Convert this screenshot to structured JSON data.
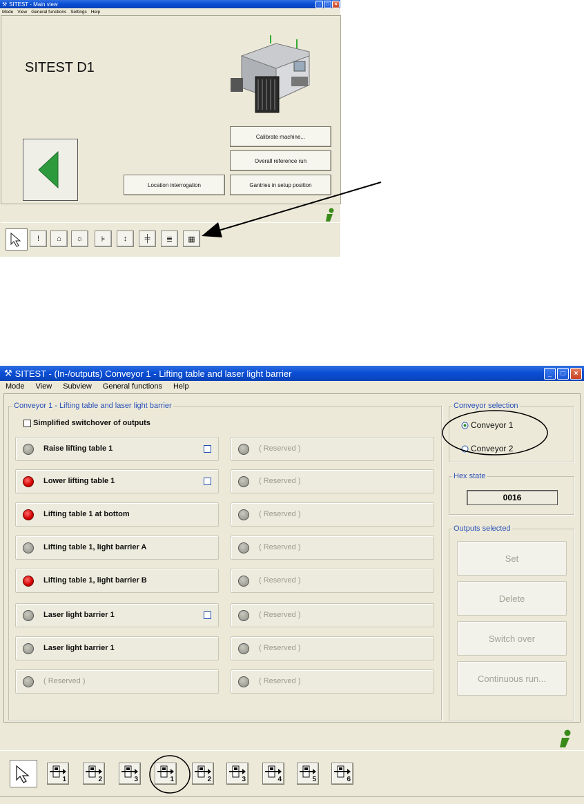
{
  "window1": {
    "title": "SITEST - Main view",
    "menu": [
      "Mode",
      "View",
      "General functions",
      "Settings",
      "Help"
    ],
    "machine_name": "SITEST D1",
    "buttons": {
      "calibrate": "Calibrate machine...",
      "reference": "Overall reference run",
      "location": "Location interrogation",
      "gantries": "Gantries in setup position"
    },
    "icons": [
      "cursor-icon",
      "warning-icon",
      "machine-icon",
      "settings-icon",
      "conveyor-icon",
      "io-icon",
      "adjust-icon",
      "list-icon",
      "grid-icon"
    ]
  },
  "window2": {
    "title": "SITEST - (In-/outputs) Conveyor 1 - Lifting table and laser light barrier",
    "menu": [
      "Mode",
      "View",
      "Subview",
      "General functions",
      "Help"
    ],
    "group_title": "Conveyor 1 - Lifting table and laser light barrier",
    "simplified_label": "Simplified switchover of outputs",
    "left_rows": [
      {
        "label": "Raise lifting table 1",
        "state": "grey",
        "checkbox": true
      },
      {
        "label": "Lower lifting table 1",
        "state": "red",
        "checkbox": true
      },
      {
        "label": "Lifting table 1 at bottom",
        "state": "red",
        "checkbox": false
      },
      {
        "label": "Lifting table 1, light barrier A",
        "state": "grey",
        "checkbox": false
      },
      {
        "label": "Lifting table 1, light barrier B",
        "state": "red",
        "checkbox": false
      },
      {
        "label": "Laser light barrier 1",
        "state": "grey",
        "checkbox": true
      },
      {
        "label": "Laser light barrier 1",
        "state": "grey",
        "checkbox": false
      },
      {
        "label": "( Reserved )",
        "state": "grey",
        "checkbox": false,
        "reserved": true
      }
    ],
    "right_rows": [
      "( Reserved )",
      "( Reserved )",
      "( Reserved )",
      "( Reserved )",
      "( Reserved )",
      "( Reserved )",
      "( Reserved )",
      "( Reserved )"
    ],
    "conveyor_selection": {
      "title": "Conveyor selection",
      "options": [
        "Conveyor 1",
        "Conveyor 2"
      ],
      "selected": 0
    },
    "hex_state": {
      "title": "Hex state",
      "value": "0016"
    },
    "outputs": {
      "title": "Outputs selected",
      "buttons": [
        "Set",
        "Delete",
        "Switch over",
        "Continuous run..."
      ]
    },
    "toolbar_labels": [
      "1",
      "2",
      "3",
      "1",
      "2",
      "3",
      "4",
      "5",
      "6"
    ]
  },
  "colors": {
    "accent_blue": "#0a4fd6",
    "led_red": "#d40000",
    "legend_blue": "#2a50b8",
    "info_green": "#3a8a1a"
  }
}
